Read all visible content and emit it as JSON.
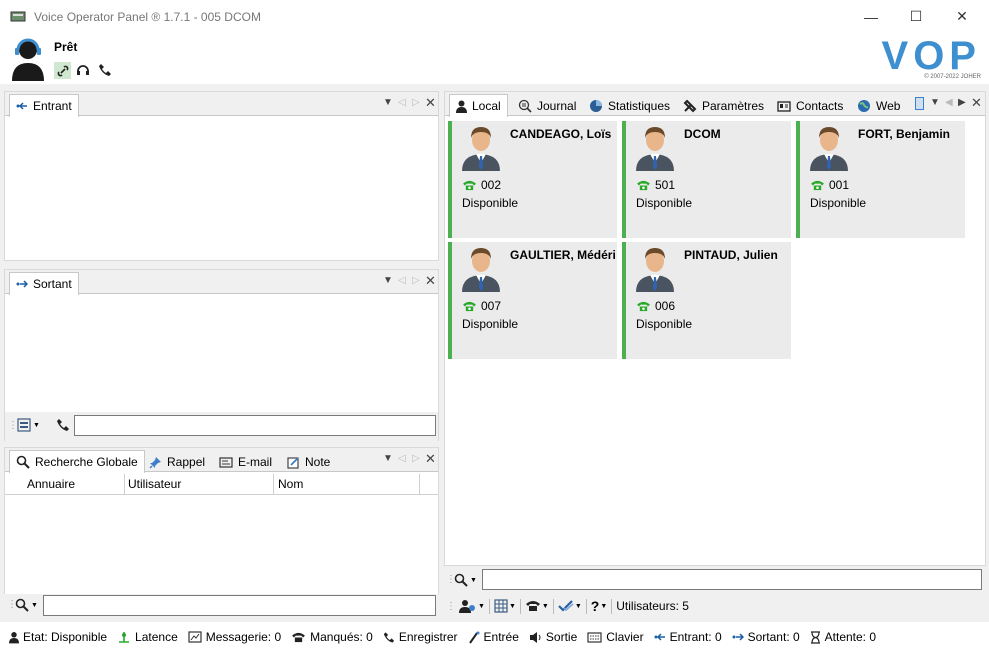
{
  "window": {
    "title": "Voice Operator Panel ® 1.7.1 - 005 DCOM",
    "minimize": "—",
    "maximize": "☐",
    "close": "✕"
  },
  "header": {
    "status": "Prêt",
    "logo": "VOP",
    "copyright": "© 2007-2022 JOHER"
  },
  "incoming": {
    "tab": "Entrant"
  },
  "outgoing": {
    "tab": "Sortant"
  },
  "search": {
    "tabs": [
      "Recherche Globale",
      "Rappel",
      "E-mail",
      "Note"
    ],
    "columns": [
      "Annuaire",
      "Utilisateur",
      "Nom"
    ]
  },
  "main": {
    "tabs": [
      "Local",
      "Journal",
      "Statistiques",
      "Paramètres",
      "Contacts",
      "Web"
    ],
    "users_count": "Utilisateurs: 5",
    "cards": [
      {
        "name": "CANDEAGO, Loïs",
        "ext": "002",
        "state": "Disponible"
      },
      {
        "name": "DCOM",
        "ext": "501",
        "state": "Disponible"
      },
      {
        "name": "FORT, Benjamin",
        "ext": "001",
        "state": "Disponible"
      },
      {
        "name": "GAULTIER, Médéric",
        "ext": "007",
        "state": "Disponible"
      },
      {
        "name": "PINTAUD, Julien",
        "ext": "006",
        "state": "Disponible"
      }
    ]
  },
  "statusbar": {
    "etat": "Etat: Disponible",
    "latence": "Latence",
    "messagerie": "Messagerie: 0",
    "manques": "Manqués: 0",
    "enregistrer": "Enregistrer",
    "entree": "Entrée",
    "sortie": "Sortie",
    "clavier": "Clavier",
    "entrant": "Entrant: 0",
    "sortant": "Sortant: 0",
    "attente": "Attente: 0"
  },
  "colors": {
    "accent": "#3e8fd0",
    "available": "#4caf50",
    "phone": "#2aa82a"
  }
}
